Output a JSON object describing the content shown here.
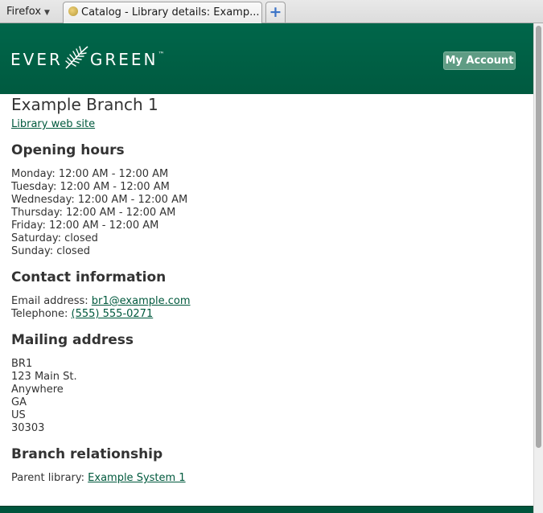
{
  "browser": {
    "menu_label": "Firefox",
    "tab_title": "Catalog - Library details: Examp...",
    "newtab_symbol": "+"
  },
  "header": {
    "logo_text_left": "EVER",
    "logo_text_right": "GREEN",
    "logo_tm": "™",
    "account_button": "My Account",
    "colors": {
      "header_bg": "#00664a",
      "link": "#00593d"
    }
  },
  "library": {
    "name": "Example Branch 1",
    "website_link": "Library web site"
  },
  "hours": {
    "heading": "Opening hours",
    "lines": [
      "Monday: 12:00 AM - 12:00 AM",
      "Tuesday: 12:00 AM - 12:00 AM",
      "Wednesday: 12:00 AM - 12:00 AM",
      "Thursday: 12:00 AM - 12:00 AM",
      "Friday: 12:00 AM - 12:00 AM",
      "Saturday: closed",
      "Sunday: closed"
    ]
  },
  "contact": {
    "heading": "Contact information",
    "email_label": "Email address:",
    "email": "br1@example.com",
    "phone_label": "Telephone:",
    "phone": "(555) 555-0271"
  },
  "mailing": {
    "heading": "Mailing address",
    "lines": [
      "BR1",
      "123 Main St.",
      "Anywhere",
      "GA",
      "US",
      "30303"
    ]
  },
  "relationship": {
    "heading": "Branch relationship",
    "parent_label": "Parent library:",
    "parent_link": "Example System 1"
  }
}
